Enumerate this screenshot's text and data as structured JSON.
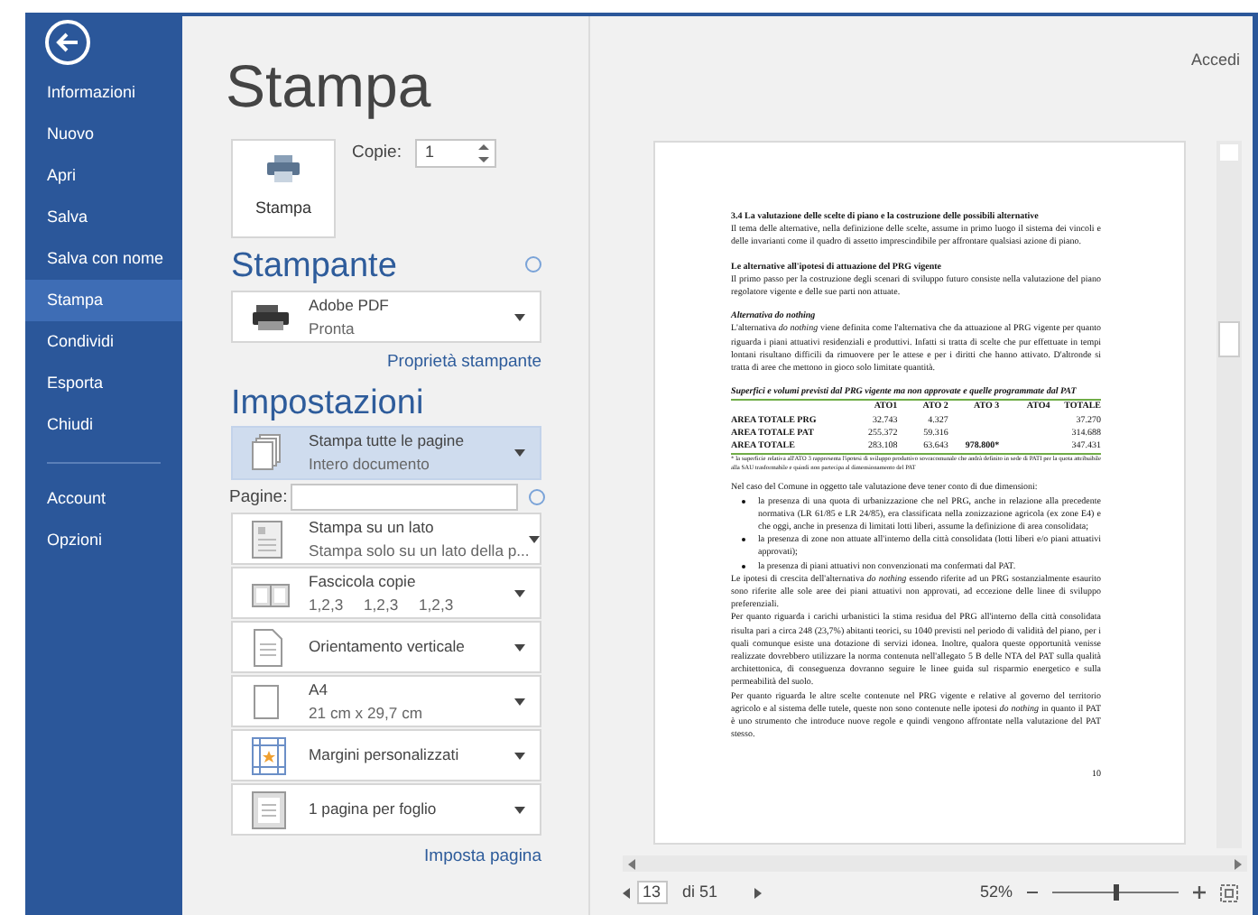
{
  "sidebar": {
    "items": [
      {
        "label": "Informazioni",
        "selected": false
      },
      {
        "label": "Nuovo",
        "selected": false
      },
      {
        "label": "Apri",
        "selected": false
      },
      {
        "label": "Salva",
        "selected": false
      },
      {
        "label": "Salva con nome",
        "selected": false
      },
      {
        "label": "Stampa",
        "selected": true
      },
      {
        "label": "Condividi",
        "selected": false
      },
      {
        "label": "Esporta",
        "selected": false
      },
      {
        "label": "Chiudi",
        "selected": false
      }
    ],
    "footer_items": [
      {
        "label": "Account",
        "selected": false
      },
      {
        "label": "Opzioni",
        "selected": false
      }
    ]
  },
  "sign_in": "Accedi",
  "title": "Stampa",
  "print_button": {
    "label": "Stampa"
  },
  "copies": {
    "label": "Copie:",
    "value": "1"
  },
  "printer_section": {
    "heading": "Stampante",
    "printer": {
      "name": "Adobe PDF",
      "status": "Pronta"
    },
    "link": "Proprietà stampante"
  },
  "settings_section": {
    "heading": "Impostazioni",
    "rows": [
      {
        "kind": "dropdown",
        "title": "Stampa tutte le pagine",
        "subtitle": "Intero documento",
        "selected": true
      },
      {
        "kind": "field",
        "label": "Pagine:"
      },
      {
        "kind": "dropdown",
        "title": "Stampa su un lato",
        "subtitle": "Stampa solo su un lato della p...",
        "selected": false
      },
      {
        "kind": "dropdown",
        "title": "Fascicola copie",
        "subtitle": "1,2,3 1,2,3 1,2,3",
        "selected": false
      },
      {
        "kind": "dropdown",
        "title": "Orientamento verticale",
        "selected": false
      },
      {
        "kind": "dropdown",
        "title": "A4",
        "subtitle": "21 cm x 29,7 cm",
        "selected": false
      },
      {
        "kind": "dropdown",
        "title": "Margini personalizzati",
        "selected": false
      },
      {
        "kind": "dropdown",
        "title": "1 pagina per foglio",
        "selected": false
      }
    ],
    "link": "Imposta pagina"
  },
  "preview": {
    "blocks": [
      {
        "kind": "heading",
        "text": "3.4 La valutazione delle scelte di piano e la costruzione delle possibili alternative"
      },
      {
        "kind": "paragraph",
        "text": "Il tema delle alternative, nella definizione delle scelte, assume in primo luogo il sistema dei vincoli e delle invarianti come il quadro di assetto imprescindibile per affrontare qualsiasi azione di piano."
      },
      {
        "kind": "subheading",
        "text": "Le alternative all'ipotesi di attuazione del PRG vigente"
      },
      {
        "kind": "paragraph",
        "text": "Il primo passo per la costruzione degli scenari di sviluppo futuro consiste nella valutazione del piano regolatore vigente e delle sue parti non attuate."
      },
      {
        "kind": "italic_heading",
        "text": "Alternativa do nothing"
      },
      {
        "kind": "paragraph",
        "text": "L'alternativa *do nothing* viene definita come l'alternativa che da attuazione al PRG vigente per quanto riguarda i piani attuativi residenziali e produttivi. Infatti si tratta di scelte che pur effettuate in tempi lontani risultano difficili da rimuovere per le attese e per i diritti che hanno attivato. D'altronde si tratta di aree che mettono in gioco solo limitate quantità."
      },
      {
        "kind": "caption",
        "text": "Superfici e volumi previsti dal PRG vigente ma non approvate e quelle programmate dal PAT"
      },
      {
        "kind": "table",
        "columns": [
          "ATO1",
          "ATO 2",
          "ATO 3",
          "ATO4",
          "TOTALE"
        ],
        "rows": [
          {
            "label": "AREA TOTALE PRG",
            "cells": [
              "32.743",
              "4.327",
              null,
              null,
              "37.270"
            ]
          },
          {
            "label": "AREA TOTALE PAT",
            "cells": [
              "255.372",
              "59.316",
              null,
              null,
              "314.688"
            ]
          },
          {
            "label": "AREA TOTALE",
            "cells": [
              "283.108",
              "63.643",
              "978.800*",
              null,
              "347.431"
            ]
          }
        ]
      },
      {
        "kind": "footnote",
        "text": "* la superficie relativa all'ATO 3 rappresenta l'ipotesi di sviluppo produttivo sovracomunale che andrà definito in sede di PATI per la quota attribuibile alla SAU trasformabile e quindi non partecipa al dimensionamento del PAT"
      },
      {
        "kind": "paragraph",
        "text": "Nel caso del Comune in oggetto tale valutazione deve tener conto di due dimensioni:"
      },
      {
        "kind": "bullets",
        "items": [
          "la presenza di una quota di urbanizzazione che nel PRG, anche in relazione alla precedente normativa (LR 61/85 e LR 24/85), era classificata nella zonizzazione agricola (ex zone E4) e che oggi, anche in presenza di limitati lotti liberi, assume la definizione di area consolidata;",
          "la presenza di zone non attuate all'interno della città consolidata (lotti liberi e/o piani attuativi approvati);",
          "la presenza di piani attuativi non convenzionati ma confermati dal PAT."
        ]
      },
      {
        "kind": "paragraph",
        "text": "Le ipotesi di crescita dell'alternativa *do nothing* essendo riferite ad un PRG sostanzialmente esaurito sono riferite alle sole aree dei piani attuativi non approvati, ad eccezione delle linee di sviluppo preferenziali."
      },
      {
        "kind": "paragraph",
        "text": "Per quanto riguarda i carichi urbanistici la stima residua del PRG all'interno della città consolidata risulta pari a circa 248 (23,7%) abitanti teorici, su 1040 previsti nel periodo di validità del piano, per i quali comunque esiste una dotazione di servizi idonea. Inoltre, qualora queste opportunità venisse realizzate dovrebbero utilizzare la norma contenuta nell'allegato 5 B delle NTA del PAT sulla qualità architettonica, di conseguenza dovranno seguire le linee guida sul risparmio energetico e sulla permeabilità del suolo."
      },
      {
        "kind": "paragraph",
        "text": "Per quanto riguarda le altre scelte contenute nel PRG vigente e relative al governo del territorio agricolo e al sistema delle tutele, queste non sono contenute nelle ipotesi *do nothing* in quanto il PAT è uno strumento che introduce nuove regole e quindi vengono affrontate nella valutazione del PAT stesso."
      },
      {
        "kind": "page_number",
        "text": "10"
      }
    ]
  },
  "navigation": {
    "page": "13",
    "total": "di 51",
    "zoom": "52%",
    "zoom_slider": {
      "level": 0.48
    }
  }
}
